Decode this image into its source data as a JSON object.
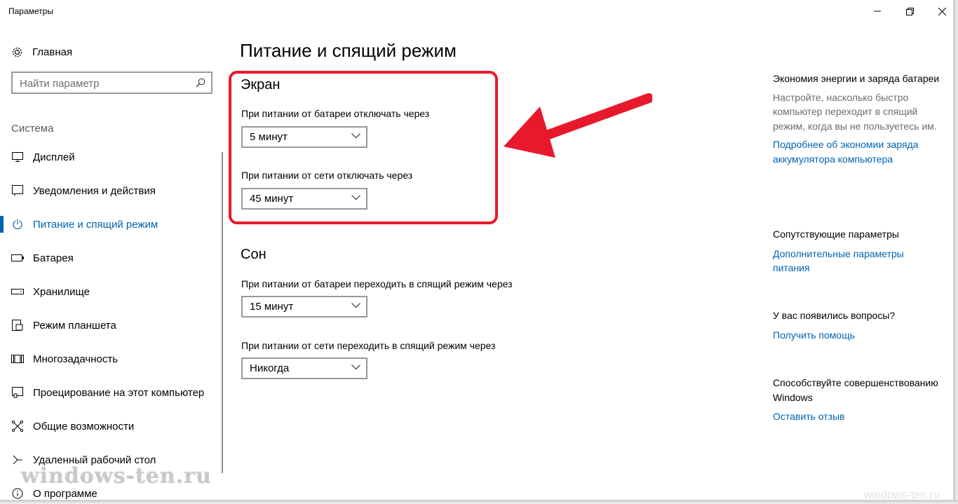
{
  "window": {
    "title": "Параметры"
  },
  "sidebar": {
    "home_label": "Главная",
    "search_placeholder": "Найти параметр",
    "section_label": "Система",
    "items": [
      {
        "label": "Дисплей",
        "icon": "display-icon"
      },
      {
        "label": "Уведомления и действия",
        "icon": "notifications-icon"
      },
      {
        "label": "Питание и спящий режим",
        "icon": "power-icon",
        "active": true
      },
      {
        "label": "Батарея",
        "icon": "battery-icon"
      },
      {
        "label": "Хранилище",
        "icon": "storage-icon"
      },
      {
        "label": "Режим планшета",
        "icon": "tablet-icon"
      },
      {
        "label": "Многозадачность",
        "icon": "multitasking-icon"
      },
      {
        "label": "Проецирование на этот компьютер",
        "icon": "projecting-icon"
      },
      {
        "label": "Общие возможности",
        "icon": "shared-experiences-icon"
      },
      {
        "label": "Удаленный рабочий стол",
        "icon": "remote-desktop-icon"
      },
      {
        "label": "О программе",
        "icon": "about-icon"
      }
    ]
  },
  "main": {
    "title": "Питание и спящий режим",
    "screen": {
      "heading": "Экран",
      "battery_label": "При питании от батареи отключать через",
      "battery_value": "5 минут",
      "plugged_label": "При питании от сети отключать через",
      "plugged_value": "45 минут"
    },
    "sleep": {
      "heading": "Сон",
      "battery_label": "При питании от батареи переходить в спящий режим через",
      "battery_value": "15 минут",
      "plugged_label": "При питании от сети переходить в спящий режим через",
      "plugged_value": "Никогда"
    }
  },
  "right": {
    "battery_saver": {
      "heading": "Экономия энергии и заряда батареи",
      "text": "Настройте, насколько быстро компьютер переходит в спящий режим, когда вы не пользуетесь им.",
      "link": "Подробнее об экономии заряда аккумулятора компьютера"
    },
    "related": {
      "heading": "Сопутствующие параметры",
      "link": "Дополнительные параметры питания"
    },
    "questions": {
      "heading": "У вас появились вопросы?",
      "link": "Получить помощь"
    },
    "improve": {
      "heading": "Способствуйте совершенствованию Windows",
      "link": "Оставить отзыв"
    }
  },
  "watermark": {
    "main": "windows-ten.ru",
    "corner": "windows-ten.ru"
  },
  "colors": {
    "accent": "#0063b1",
    "highlight": "#e8192c"
  }
}
